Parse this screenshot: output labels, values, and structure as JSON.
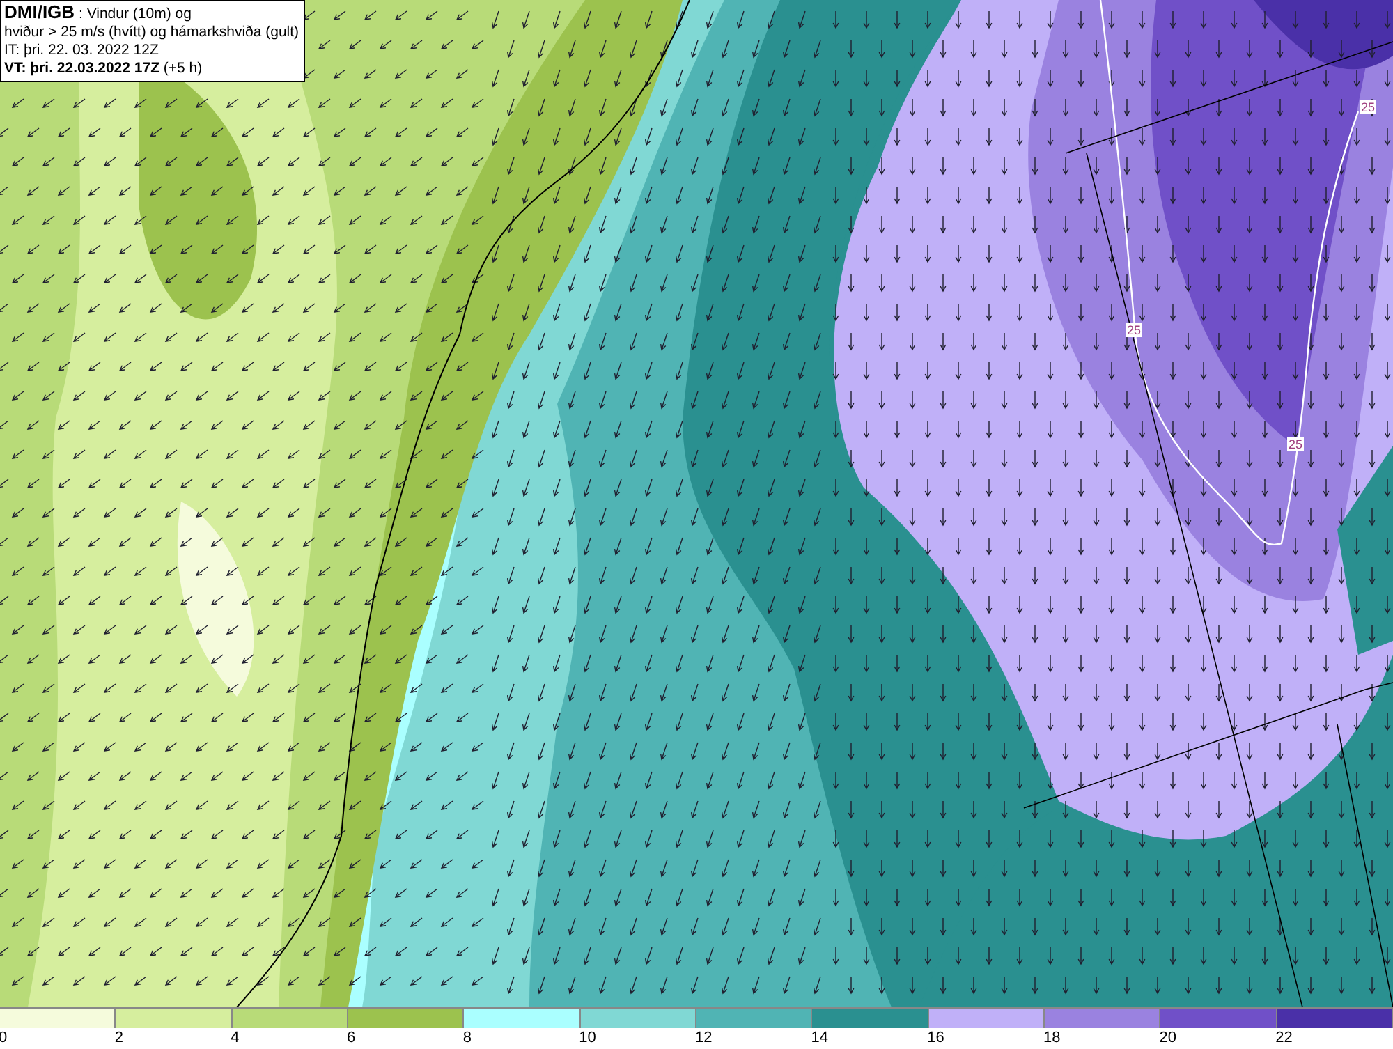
{
  "header": {
    "lines": [
      "**DMI/IGB** : Vindur (10m) og",
      "hviður > 25 m/s (hvítt) og hámarkshviða (gult)",
      "IT: þri. 22. 03. 2022 12Z",
      "**VT: þri. 22.03.2022 17Z** (+5 h)"
    ]
  },
  "map": {
    "contour_labels": [
      "25",
      "25",
      "25"
    ]
  },
  "legend": [
    {
      "label": "0",
      "color": "#f5fbdc"
    },
    {
      "label": "2",
      "color": "#d6ee9e"
    },
    {
      "label": "4",
      "color": "#b8db78"
    },
    {
      "label": "6",
      "color": "#9cc24e"
    },
    {
      "label": "8",
      "color": "#aaffff"
    },
    {
      "label": "10",
      "color": "#80d8d4"
    },
    {
      "label": "12",
      "color": "#50b4b4"
    },
    {
      "label": "14",
      "color": "#2a9090"
    },
    {
      "label": "16",
      "color": "#c0b0f8"
    },
    {
      "label": "18",
      "color": "#9a82e0"
    },
    {
      "label": "20",
      "color": "#7050c8"
    },
    {
      "label": "22",
      "color": "#4a30a8"
    }
  ]
}
